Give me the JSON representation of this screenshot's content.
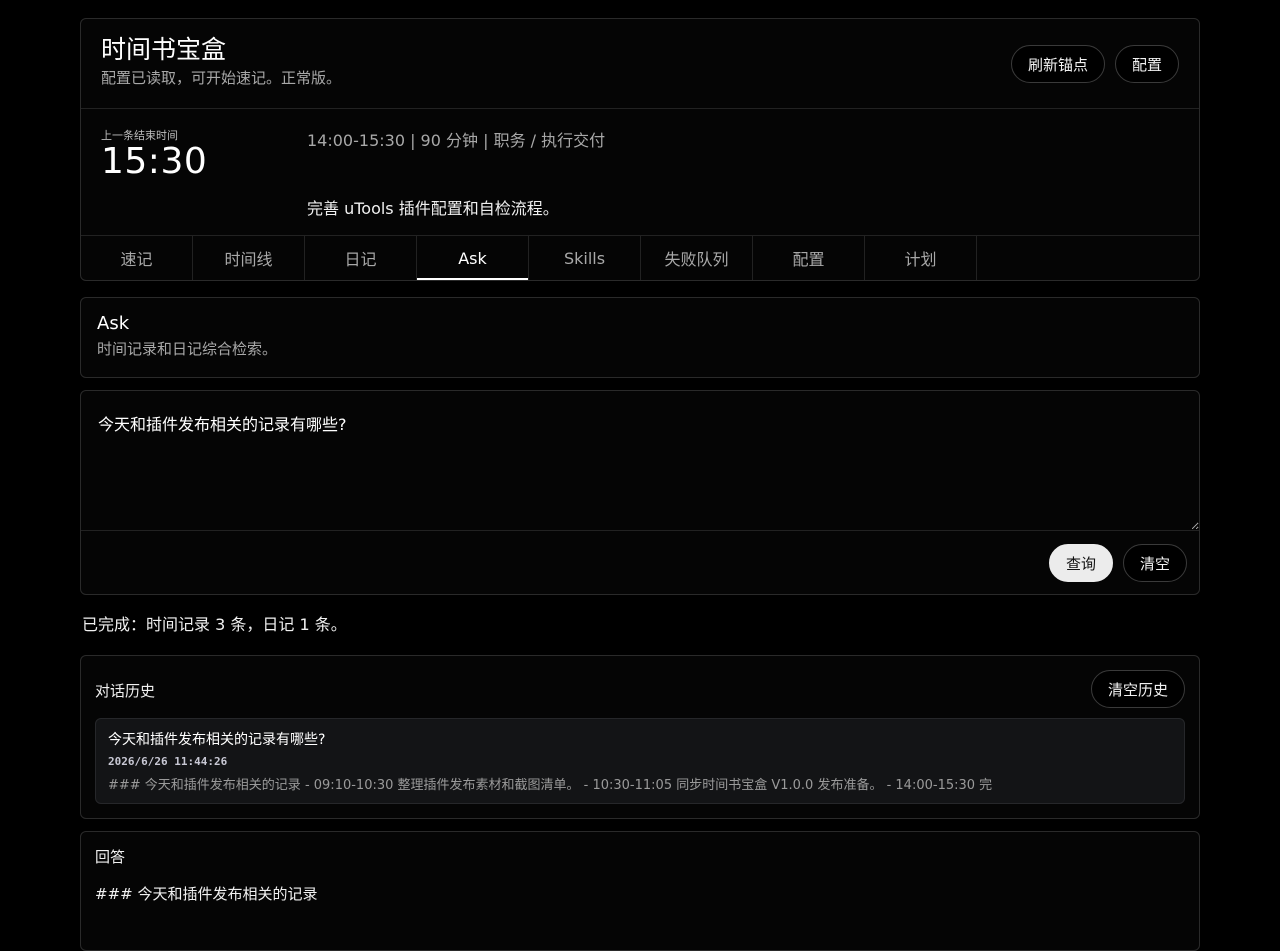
{
  "header": {
    "title": "时间书宝盒",
    "subtitle": "配置已读取，可开始速记。正常版。",
    "refresh_anchor_label": "刷新锚点",
    "config_label": "配置"
  },
  "status": {
    "last_end_label": "上一条结束时间",
    "last_end_time": "15:30",
    "last_entry_meta": "14:00-15:30 | 90 分钟 | 职务 / 执行交付",
    "last_entry_desc": "完善 uTools 插件配置和自检流程。"
  },
  "tabs": [
    {
      "label": "速记",
      "active": false
    },
    {
      "label": "时间线",
      "active": false
    },
    {
      "label": "日记",
      "active": false
    },
    {
      "label": "Ask",
      "active": true
    },
    {
      "label": "Skills",
      "active": false
    },
    {
      "label": "失败队列",
      "active": false
    },
    {
      "label": "配置",
      "active": false
    },
    {
      "label": "计划",
      "active": false
    }
  ],
  "ask": {
    "title": "Ask",
    "subtitle": "时间记录和日记综合检索。",
    "query_value": "今天和插件发布相关的记录有哪些?",
    "query_button": "查询",
    "clear_button": "清空",
    "result_status": "已完成：时间记录 3 条，日记 1 条。"
  },
  "history": {
    "title": "对话历史",
    "clear_label": "清空历史",
    "entries": [
      {
        "question": "今天和插件发布相关的记录有哪些?",
        "time": "2026/6/26 11:44:26",
        "preview": "### 今天和插件发布相关的记录 - 09:10-10:30 整理插件发布素材和截图清单。 - 10:30-11:05 同步时间书宝盒 V1.0.0 发布准备。 - 14:00-15:30 完"
      }
    ]
  },
  "answer": {
    "title": "回答",
    "body_first_line": "### 今天和插件发布相关的记录"
  },
  "colors": {
    "background": "#000000",
    "card_border": "#2a2a2a",
    "primary_button": "#ececec",
    "history_entry_bg": "#131416"
  }
}
